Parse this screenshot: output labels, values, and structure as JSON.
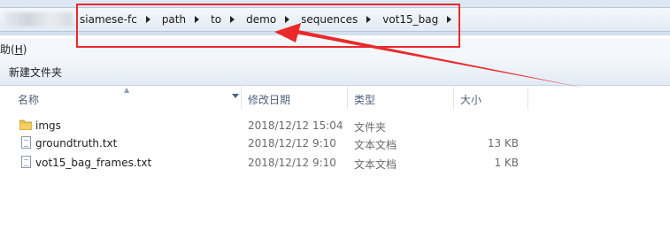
{
  "breadcrumb": [
    "siamese-fc",
    "path",
    "to",
    "demo",
    "sequences",
    "vot15_bag"
  ],
  "menu": {
    "help_label": "助(",
    "help_key": "H",
    "help_tail": ")"
  },
  "toolbar": {
    "new_folder_label": "新建文件夹"
  },
  "columns": {
    "name": "名称",
    "date": "修改日期",
    "type": "类型",
    "size": "大小"
  },
  "files": [
    {
      "name": "imgs",
      "date": "2018/12/12 15:04",
      "type": "文件夹",
      "size": "",
      "icon": "folder-icon"
    },
    {
      "name": "groundtruth.txt",
      "date": "2018/12/12 9:10",
      "type": "文本文档",
      "size": "13 KB",
      "icon": "text-file-icon"
    },
    {
      "name": "vot15_bag_frames.txt",
      "date": "2018/12/12 9:10",
      "type": "文本文档",
      "size": "1 KB",
      "icon": "text-file-icon"
    }
  ],
  "colors": {
    "annotation_red": "#ea2a2a",
    "accent_blue": "#4c607a"
  }
}
